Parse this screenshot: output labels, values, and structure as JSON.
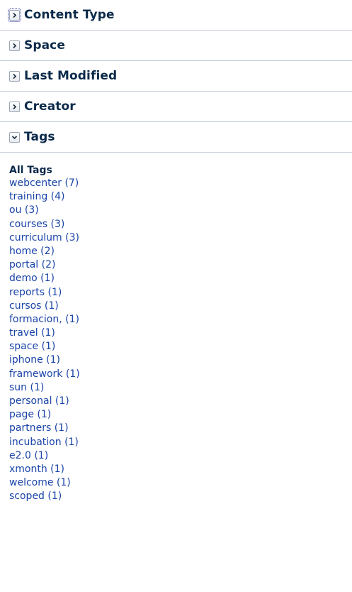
{
  "facets": [
    {
      "label": "Content Type",
      "expanded": false
    },
    {
      "label": "Space",
      "expanded": false
    },
    {
      "label": "Last Modified",
      "expanded": false
    },
    {
      "label": "Creator",
      "expanded": false
    },
    {
      "label": "Tags",
      "expanded": true
    }
  ],
  "tags_panel": {
    "heading": "All Tags",
    "tags": [
      "webcenter (7)",
      "training (4)",
      "ou (3)",
      "courses (3)",
      "curriculum (3)",
      "home (2)",
      "portal (2)",
      "demo (1)",
      "reports (1)",
      "cursos (1)",
      "formacion, (1)",
      "travel (1)",
      "space (1)",
      "iphone (1)",
      "framework (1)",
      "sun (1)",
      "personal (1)",
      "page (1)",
      "partners (1)",
      "incubation (1)",
      "e2.0 (1)",
      "xmonth (1)",
      "welcome (1)",
      "scoped (1)"
    ]
  },
  "colors": {
    "heading_text": "#0b2a4a",
    "link_text": "#1a44a8",
    "divider": "#c3ccd8"
  }
}
